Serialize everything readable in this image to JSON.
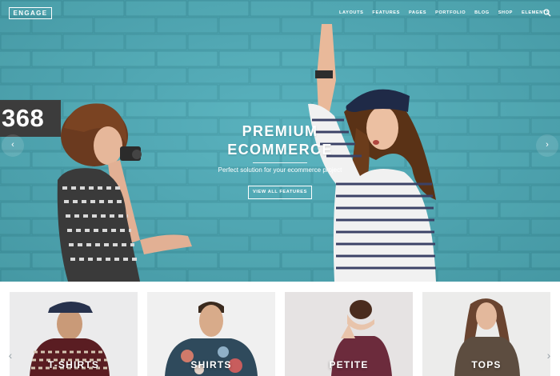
{
  "header": {
    "logo": "ENGAGE",
    "nav": [
      "LAYOUTS",
      "FEATURES",
      "PAGES",
      "PORTFOLIO",
      "BLOG",
      "SHOP",
      "ELEMENTS"
    ],
    "search_icon": "search-icon"
  },
  "hero": {
    "house_number": "368",
    "title_line1": "PREMIUM",
    "title_line2": "ECOMMERCE",
    "subtitle": "Perfect solution for your ecommerce project",
    "button_label": "VIEW ALL FEATURES",
    "prev_arrow": "‹",
    "next_arrow": "›",
    "wall_color": "#4aa9b6"
  },
  "categories": {
    "items": [
      {
        "label": "T-SHIRTS"
      },
      {
        "label": "SHIRTS"
      },
      {
        "label": "PETITE"
      },
      {
        "label": "TOPS"
      }
    ],
    "prev_arrow": "‹",
    "next_arrow": "›"
  }
}
